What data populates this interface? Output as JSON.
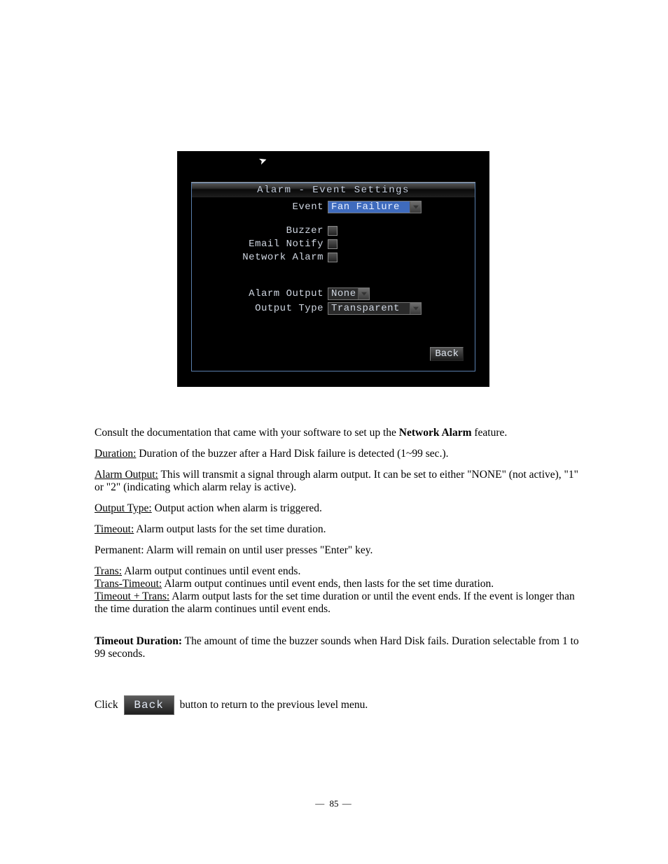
{
  "screenshot": {
    "title": "Alarm - Event Settings",
    "fields": {
      "event_label": "Event",
      "event_value": "Fan Failure",
      "buzzer_label": "Buzzer",
      "email_label": "Email Notify",
      "network_label": "Network Alarm",
      "alarm_output_label": "Alarm Output",
      "alarm_output_value": "None",
      "output_type_label": "Output Type",
      "output_type_value": "Transparent"
    },
    "back_label": "Back"
  },
  "doc": {
    "p1_prefix": "Consult the documentation that came with your software to set up the ",
    "p1_bold": "Network Alarm",
    "p1_suffix": " feature.",
    "d1_label": "Duration:",
    "d1_text": " Duration of the buzzer after a Hard Disk failure is detected (1~99 sec.).",
    "d2_label": "Alarm Output:",
    "d2_text": " This will transmit a signal through alarm output. It can be set to either \"NONE\" (not active), \"1\" or \"2\" (indicating which alarm relay is active).",
    "d3_label": "Output Type:",
    "d3_text": " Output action when alarm is triggered.",
    "d4_label": "Timeout:",
    "d4_text": " Alarm output lasts for the set time duration.",
    "d4_sub": "Permanent: Alarm will remain on until user presses \"Enter\" key.",
    "d5_label": "Trans:",
    "d5_text": " Alarm output continues until event ends.",
    "d6_label": "Trans-Timeout:",
    "d6_text": " Alarm output continues until event ends, then lasts for the set time duration.",
    "d7_label": "Timeout + Trans:",
    "d7_text": " Alarm output lasts for the set time duration or until the event ends. If the event is longer than the time duration the alarm continues until event ends.",
    "d8_label": "Timeout Duration:",
    "d8_text": " The amount of time the buzzer sounds when Hard Disk fails. Duration selectable from 1 to 99 seconds.",
    "click_prefix": "Click ",
    "back_pill": "Back",
    "click_suffix": " button to return to the previous level menu."
  },
  "page_number": "85"
}
